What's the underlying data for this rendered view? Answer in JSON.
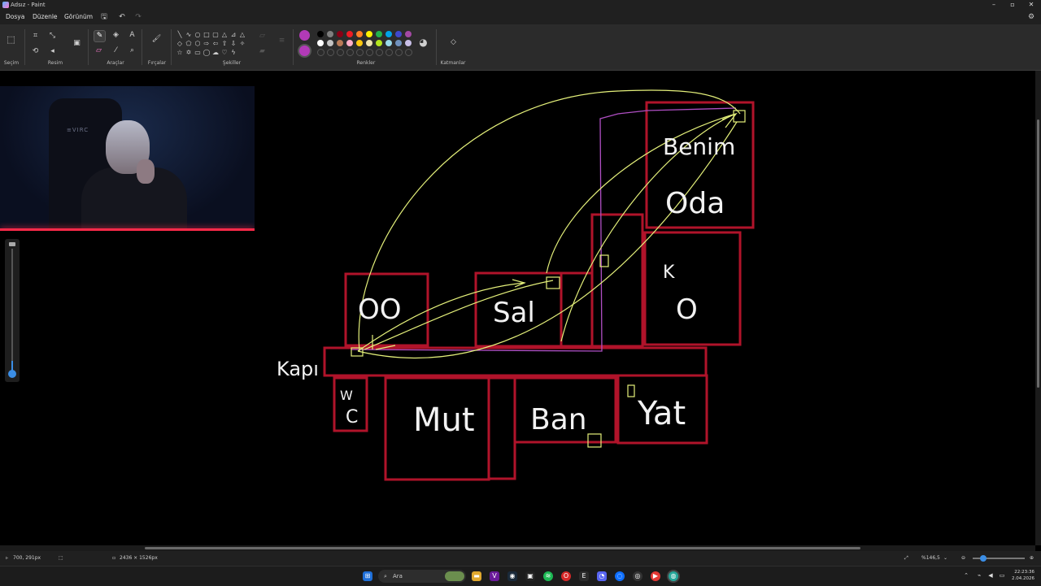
{
  "window": {
    "title": "Adsız - Paint"
  },
  "menu": {
    "file": "Dosya",
    "edit": "Düzenle",
    "view": "Görünüm"
  },
  "ribbon": {
    "groups": {
      "selection": "Seçim",
      "image": "Resim",
      "tools": "Araçlar",
      "brushes": "Fırçalar",
      "shapes": "Şekiller",
      "colors": "Renkler",
      "layers": "Katmanlar"
    },
    "primary_color": "#b23ab7",
    "secondary_color": "#b23ab7",
    "palette_row1": [
      "#000000",
      "#7f7f7f",
      "#880015",
      "#ed1c24",
      "#ff7f27",
      "#fff200",
      "#22b14c",
      "#00a2e8",
      "#3f48cc",
      "#a349a4"
    ],
    "palette_row2": [
      "#ffffff",
      "#c3c3c3",
      "#b97a57",
      "#ffaec9",
      "#ffc90e",
      "#efe4b0",
      "#b5e61d",
      "#99d9ea",
      "#7092be",
      "#c8bfe7"
    ]
  },
  "drawing": {
    "labels": {
      "room1": "OO",
      "room2": "Sal",
      "room3a": "Benim",
      "room3b": "Oda",
      "room4a": "K",
      "room4b": "O",
      "door": "Kapı",
      "wc_a": "W",
      "wc_b": "C",
      "kitchen": "Mut",
      "bath": "Ban",
      "bed": "Yat"
    },
    "room_color": "#b0132a",
    "path_color": "#e4f07a",
    "route_color": "#b04fc4"
  },
  "status": {
    "cursor": "700, 291px",
    "canvas_size": "2436 × 1526px",
    "zoom": "%146,5"
  },
  "taskbar": {
    "search": "Ara",
    "time": "22:23:36",
    "date": "2.04.2026"
  }
}
